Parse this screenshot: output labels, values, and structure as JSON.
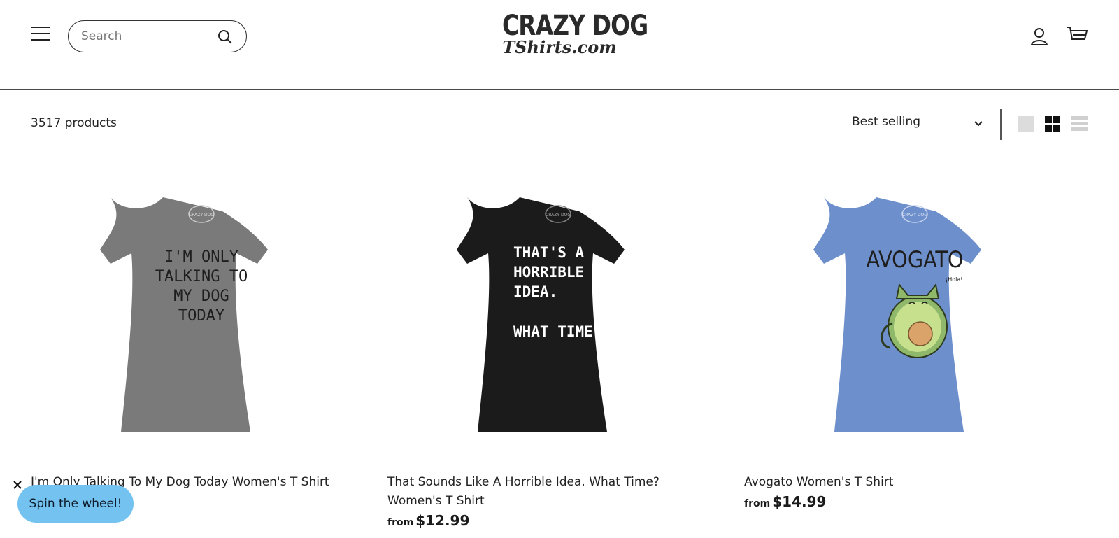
{
  "header": {
    "search_placeholder": "Search",
    "logo_top": "CRAZY DOG",
    "logo_bottom": "TShirts.com"
  },
  "toolbar": {
    "product_count": "3517 products",
    "sort_selected": "Best selling",
    "view_modes": [
      "large-grid",
      "small-grid",
      "list"
    ],
    "active_view": "small-grid"
  },
  "products": [
    {
      "title": "I'm Only Talking To My Dog Today Women's T Shirt",
      "shirt_color": "#7a7a7a",
      "shirt_print": [
        "I'M ONLY",
        "TALKING TO",
        "MY DOG",
        "TODAY"
      ],
      "shirt_print_color": "#1e1e1e"
    },
    {
      "title": "That Sounds Like A Horrible Idea. What Time? Women's T Shirt",
      "price_prefix": "from",
      "price": "$12.99",
      "shirt_color": "#1b1b1b",
      "shirt_print": [
        "THAT'S A",
        "HORRIBLE",
        "IDEA.",
        "",
        "WHAT TIME?"
      ],
      "shirt_print_color": "#ffffff"
    },
    {
      "title": "Avogato Women's T Shirt",
      "price_prefix": "from",
      "price": "$14.99",
      "shirt_color": "#6d8fcc",
      "shirt_print": [
        "AVOGATO"
      ],
      "shirt_print_color": "#1e1e1e",
      "bubble_text": "¡Hola!"
    }
  ],
  "shirt_brand_tag": "CRAZY DOG",
  "popup": {
    "spin_label": "Spin the wheel!",
    "close_symbol": "✕"
  },
  "colors": {
    "accent_button": "#74c2f0",
    "text": "#222222"
  }
}
